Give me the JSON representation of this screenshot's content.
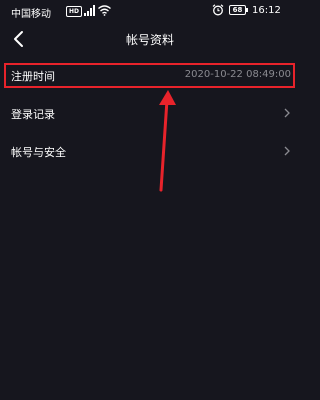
{
  "status_bar": {
    "carrier": "中国移动",
    "network_badge": "HD",
    "battery": "68",
    "time": "16:12"
  },
  "header": {
    "title": "帐号资料",
    "back_icon": "chevron-left-icon"
  },
  "rows": [
    {
      "label": "注册时间",
      "value": "2020-10-22 08:49:00",
      "highlighted": true
    },
    {
      "label": "登录记录",
      "icon": "chevron-right-icon"
    },
    {
      "label": "帐号与安全",
      "icon": "chevron-right-icon"
    }
  ],
  "colors": {
    "background": "#16161e",
    "highlight": "#e8232b",
    "secondary_text": "#8a8a90"
  }
}
